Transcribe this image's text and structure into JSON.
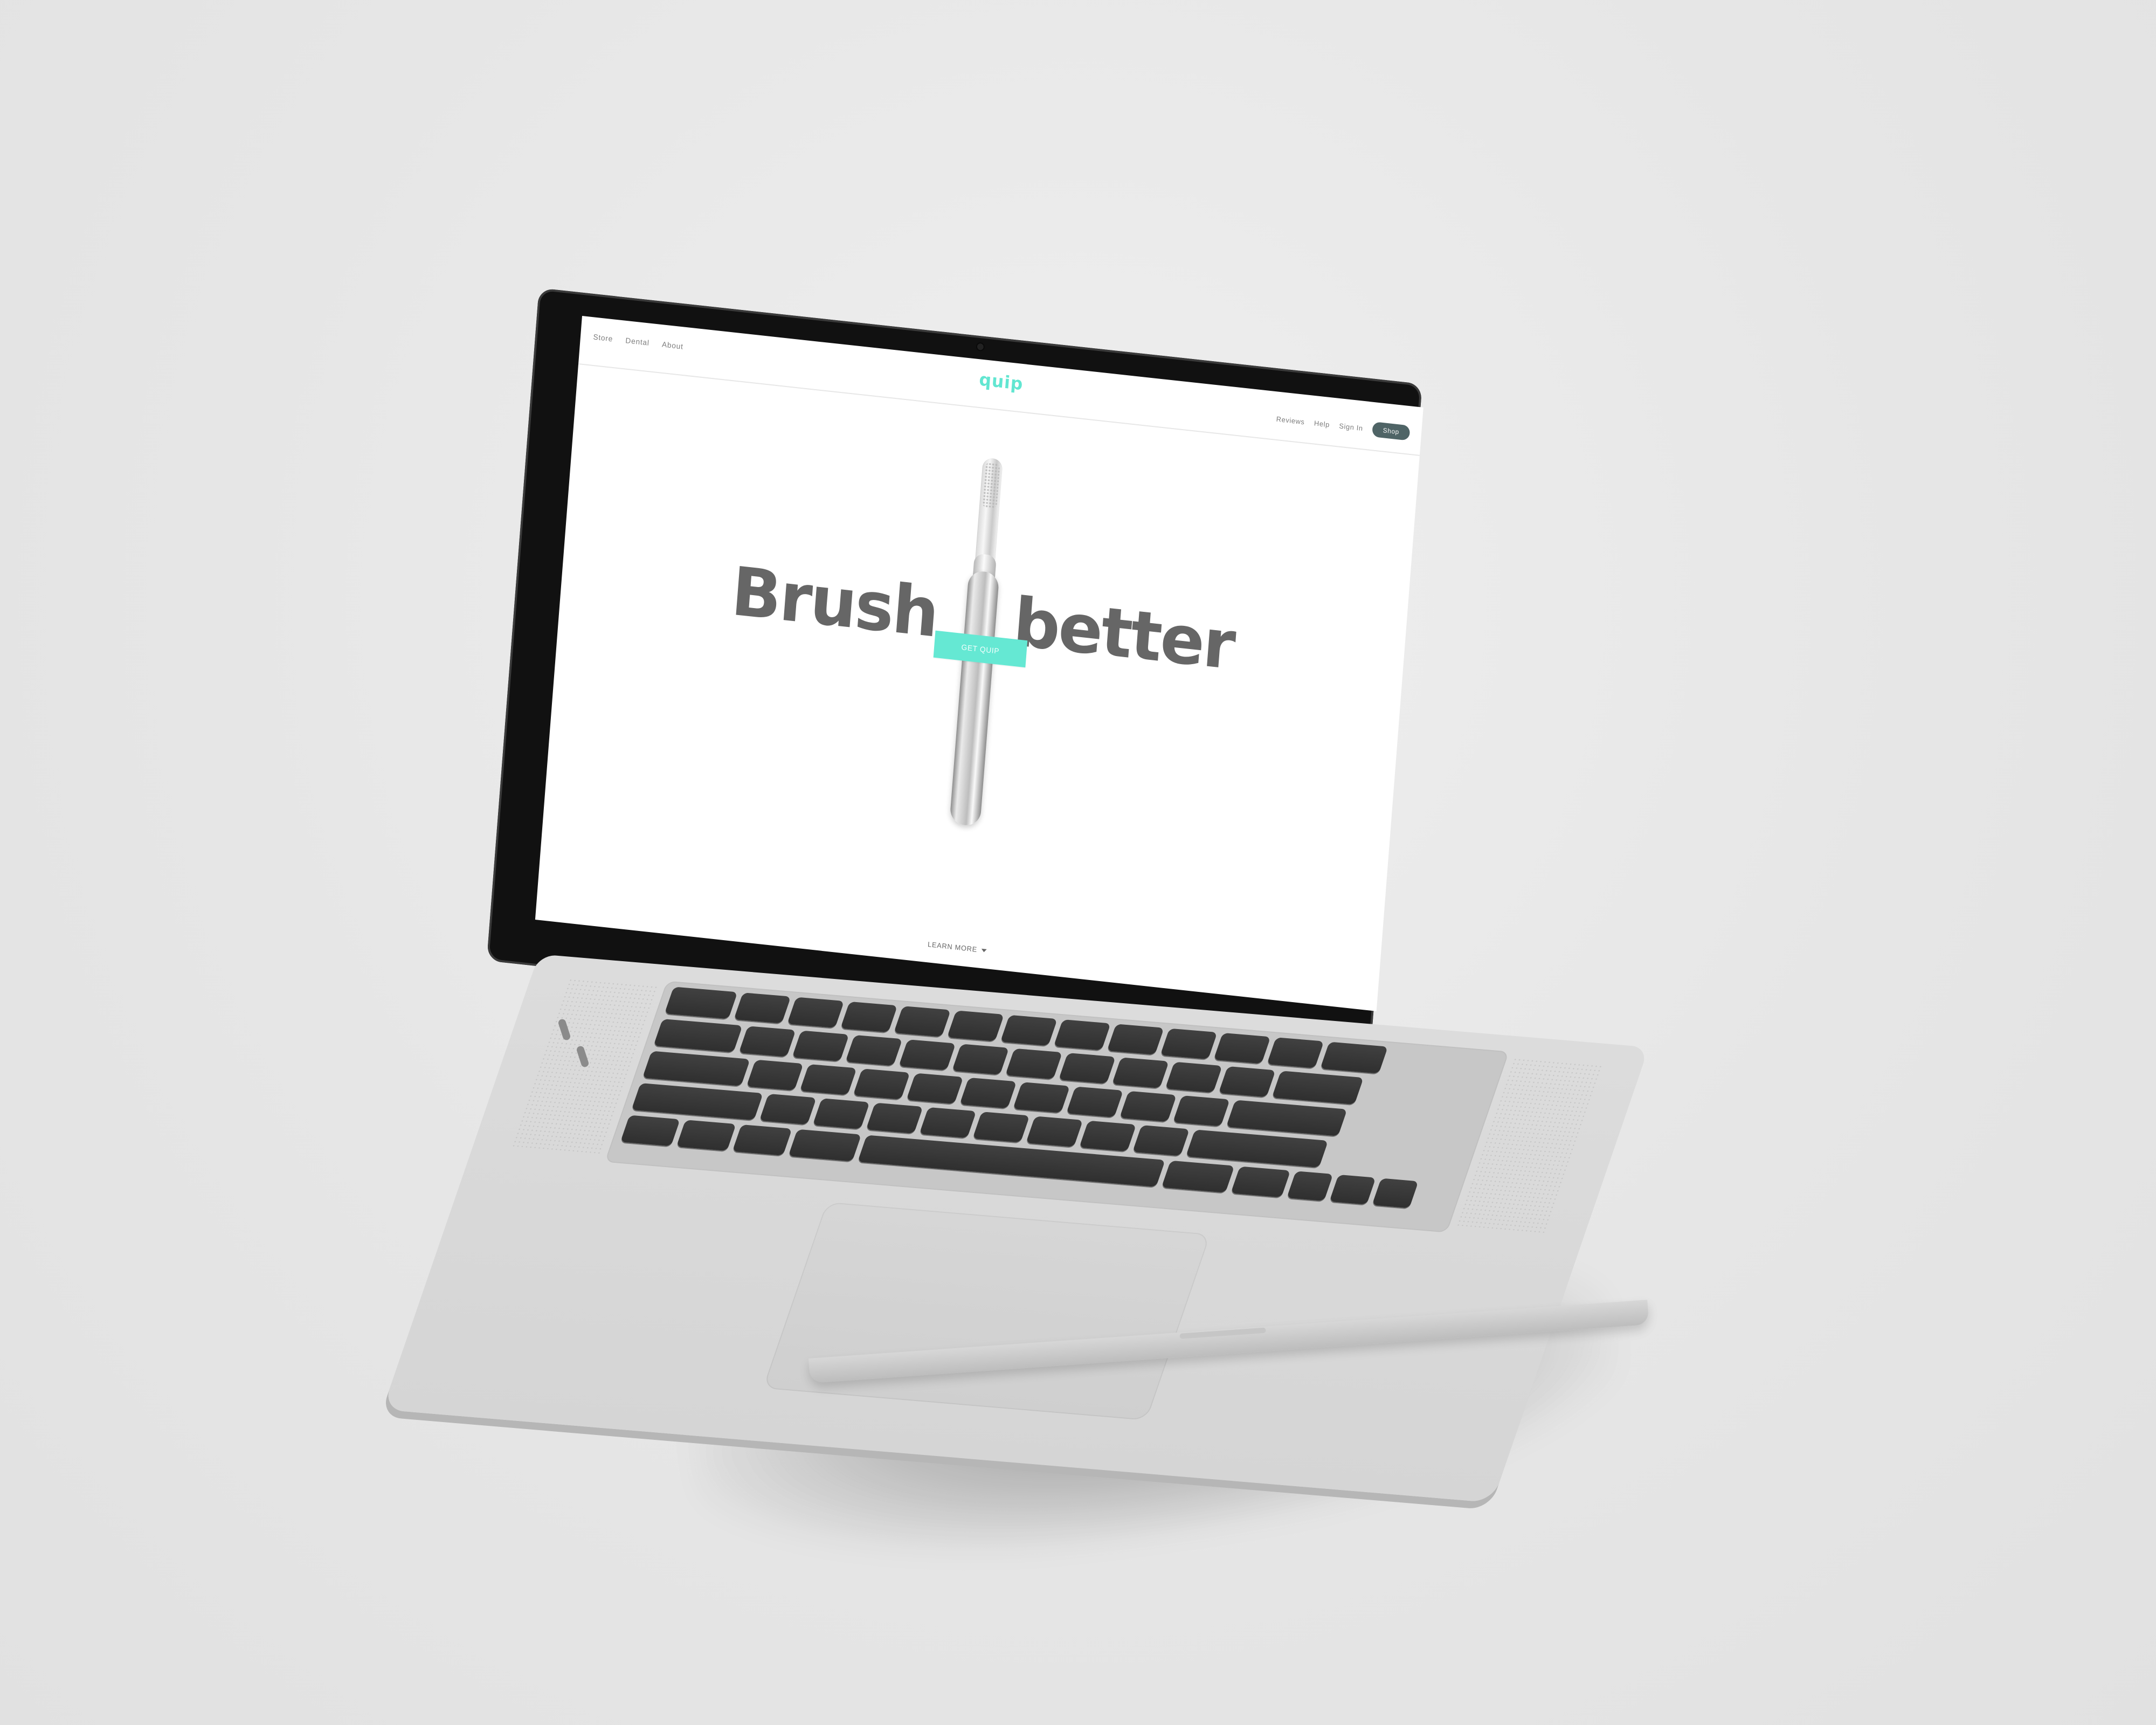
{
  "site": {
    "logo": "quip",
    "nav_left": [
      "Store",
      "Dental",
      "About"
    ],
    "nav_right": [
      "Reviews",
      "Help",
      "Sign In"
    ],
    "shop_label": "Shop"
  },
  "hero": {
    "title_left": "Brush",
    "title_right": "better",
    "cta_label": "GET QUIP",
    "learn_more_label": "LEARN MORE"
  },
  "colors": {
    "accent": "#65e8d3",
    "shop_button": "#4f6466",
    "text_gray": "#666666"
  }
}
